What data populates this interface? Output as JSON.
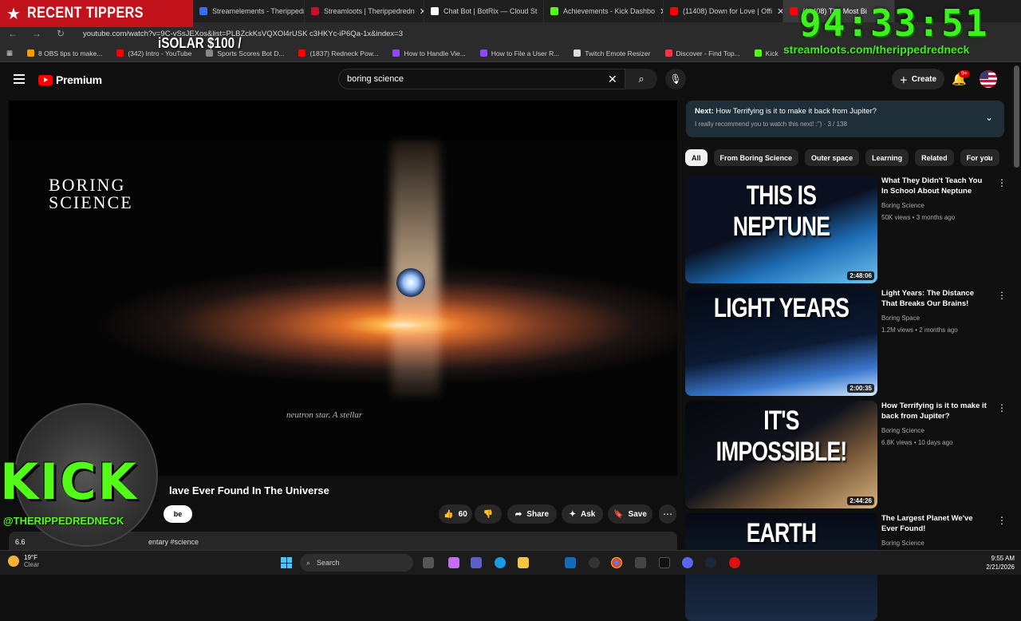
{
  "browser": {
    "tabs": [
      {
        "label": "Streamelements - Therippedred",
        "color": "#3a6df0"
      },
      {
        "label": "Streamloots | Therippedredn",
        "color": "#c8102e"
      },
      {
        "label": "Chat Bot | BotRix — Cloud St",
        "color": "#ffffff"
      },
      {
        "label": "Achievements - Kick Dashbo",
        "color": "#53fc18"
      },
      {
        "label": "(11408) Down for Love | Offi",
        "color": "#ff0000"
      },
      {
        "label": "(11408) The Most Bi",
        "color": "#ff0000"
      }
    ],
    "url": "youtube.com/watch?v=9C-vSsJEXos&list=PLBZckKsVQXOl4rUSK c3HKYc-iP6Qa-1x&index=3",
    "bookmarks": [
      {
        "label": "8 OBS tips to make...",
        "color": "#ff9900"
      },
      {
        "label": "(342) Intro - YouTube",
        "color": "#ff0000"
      },
      {
        "label": "Sports Scores Bot D...",
        "color": "#888888"
      },
      {
        "label": "(1837) Redneck Pow...",
        "color": "#ff0000"
      },
      {
        "label": "How to Handle Vie...",
        "color": "#9146ff"
      },
      {
        "label": "How to File a User R...",
        "color": "#9146ff"
      },
      {
        "label": "Twitch Emote Resizer",
        "color": "#dddddd"
      },
      {
        "label": "Discover - Find Top...",
        "color": "#ff3344"
      },
      {
        "label": "Kick",
        "color": "#53fc18"
      }
    ]
  },
  "overlay": {
    "tippers_title": "RECENT TIPPERS",
    "tipper_line": "iSOLAR $100 /",
    "timer": "94:33:51",
    "stream_url": "streamloots.com/therippedredneck",
    "kick_text": "KICK",
    "kick_handle": "@THERIPPEDREDNECK"
  },
  "youtube": {
    "logo_label": "Premium",
    "search_value": "boring science",
    "create_label": "Create",
    "notif_count": "9+",
    "video": {
      "brand": "BORING SCIENCE",
      "caption": "neutron star. A stellar",
      "title": "lave Ever Found In The Universe",
      "likes": "60",
      "share_label": "Share",
      "ask_label": "Ask",
      "save_label": "Save",
      "desc_views": "6.6",
      "desc_tags": "entary #science",
      "sub_label": "be"
    },
    "next": {
      "prefix": "Next:",
      "title": "How Terrifying is it to make it back from Jupiter?",
      "sub": "I really recommend you to watch this next! :\") · 3 / 138"
    },
    "chips": [
      "All",
      "From Boring Science",
      "Outer space",
      "Learning",
      "Related",
      "For you"
    ],
    "recs": [
      {
        "thumb_text": "THIS IS NEPTUNE",
        "duration": "2:48:06",
        "title": "What They Didn't Teach You In School About Neptune",
        "channel": "Boring Science",
        "meta": "50K views • 3 months ago",
        "bg": "linear-gradient(160deg,#0a1020 0%,#0a1020 45%,#1f6fb8 70%,#6fc3f0 100%)"
      },
      {
        "thumb_text": "LIGHT YEARS",
        "duration": "2:00:35",
        "title": "Light Years: The Distance That Breaks Our Brains!",
        "channel": "Boring Space",
        "meta": "1.2M views • 2 months ago",
        "bg": "linear-gradient(170deg,#040812 0%,#0b1a33 55%,#3b7ad0 80%,#d8ecff 100%)"
      },
      {
        "thumb_text": "IT'S IMPOSSIBLE!",
        "duration": "2:44:26",
        "title": "How Terrifying is it to make it back from Jupiter?",
        "channel": "Boring Science",
        "meta": "6.8K views • 10 days ago",
        "bg": "linear-gradient(150deg,#05070d 0%,#10131c 45%,#7a5a3a 70%,#d8b27a 100%)"
      },
      {
        "thumb_text": "EARTH",
        "duration": "",
        "title": "The Largest Planet We've Ever Found!",
        "channel": "Boring Science",
        "meta": "",
        "bg": "linear-gradient(180deg,#060a14 0%,#1a2a44 100%)"
      }
    ]
  },
  "taskbar": {
    "temp": "19°F",
    "condition": "Clear",
    "search_placeholder": "Search",
    "time": "9:55 AM",
    "date": "2/21/2026"
  }
}
